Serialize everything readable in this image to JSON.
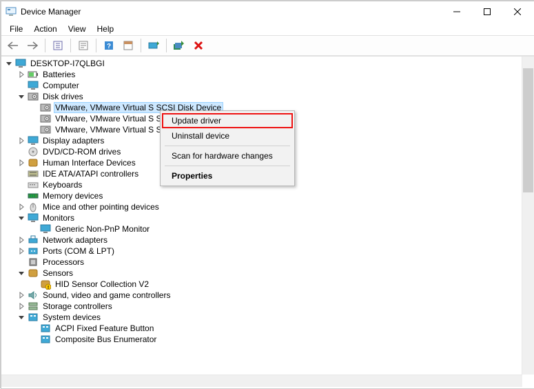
{
  "window": {
    "title": "Device Manager"
  },
  "menus": {
    "file": "File",
    "action": "Action",
    "view": "View",
    "help": "Help"
  },
  "tree": [
    {
      "lvl": 0,
      "exp": "open",
      "icon": "computer",
      "label": "DESKTOP-I7QLBGI"
    },
    {
      "lvl": 1,
      "exp": "closed",
      "icon": "battery",
      "label": "Batteries"
    },
    {
      "lvl": 1,
      "exp": "none",
      "icon": "computer",
      "label": "Computer"
    },
    {
      "lvl": 1,
      "exp": "open",
      "icon": "disk",
      "label": "Disk drives"
    },
    {
      "lvl": 2,
      "exp": "none",
      "icon": "disk",
      "label": "VMware, VMware Virtual S SCSI Disk Device",
      "sel": true
    },
    {
      "lvl": 2,
      "exp": "none",
      "icon": "disk",
      "label": "VMware, VMware Virtual S SCSI Disk Device"
    },
    {
      "lvl": 2,
      "exp": "none",
      "icon": "disk",
      "label": "VMware, VMware Virtual S SCSI Disk Device"
    },
    {
      "lvl": 1,
      "exp": "closed",
      "icon": "display",
      "label": "Display adapters"
    },
    {
      "lvl": 1,
      "exp": "none",
      "icon": "dvd",
      "label": "DVD/CD-ROM drives"
    },
    {
      "lvl": 1,
      "exp": "closed",
      "icon": "hid",
      "label": "Human Interface Devices"
    },
    {
      "lvl": 1,
      "exp": "none",
      "icon": "ata",
      "label": "IDE ATA/ATAPI controllers"
    },
    {
      "lvl": 1,
      "exp": "none",
      "icon": "keyboard",
      "label": "Keyboards"
    },
    {
      "lvl": 1,
      "exp": "none",
      "icon": "memory",
      "label": "Memory devices"
    },
    {
      "lvl": 1,
      "exp": "closed",
      "icon": "mouse",
      "label": "Mice and other pointing devices"
    },
    {
      "lvl": 1,
      "exp": "open",
      "icon": "monitor",
      "label": "Monitors"
    },
    {
      "lvl": 2,
      "exp": "none",
      "icon": "monitor",
      "label": "Generic Non-PnP Monitor"
    },
    {
      "lvl": 1,
      "exp": "closed",
      "icon": "network",
      "label": "Network adapters"
    },
    {
      "lvl": 1,
      "exp": "closed",
      "icon": "port",
      "label": "Ports (COM & LPT)"
    },
    {
      "lvl": 1,
      "exp": "none",
      "icon": "cpu",
      "label": "Processors"
    },
    {
      "lvl": 1,
      "exp": "open",
      "icon": "sensor",
      "label": "Sensors"
    },
    {
      "lvl": 2,
      "exp": "none",
      "icon": "sensor-warn",
      "label": "HID Sensor Collection V2"
    },
    {
      "lvl": 1,
      "exp": "closed",
      "icon": "sound",
      "label": "Sound, video and game controllers"
    },
    {
      "lvl": 1,
      "exp": "closed",
      "icon": "storage",
      "label": "Storage controllers"
    },
    {
      "lvl": 1,
      "exp": "open",
      "icon": "system",
      "label": "System devices"
    },
    {
      "lvl": 2,
      "exp": "none",
      "icon": "system",
      "label": "ACPI Fixed Feature Button"
    },
    {
      "lvl": 2,
      "exp": "none",
      "icon": "system",
      "label": "Composite Bus Enumerator"
    }
  ],
  "context_menu": {
    "update": "Update driver",
    "uninstall": "Uninstall device",
    "scan": "Scan for hardware changes",
    "properties": "Properties"
  }
}
